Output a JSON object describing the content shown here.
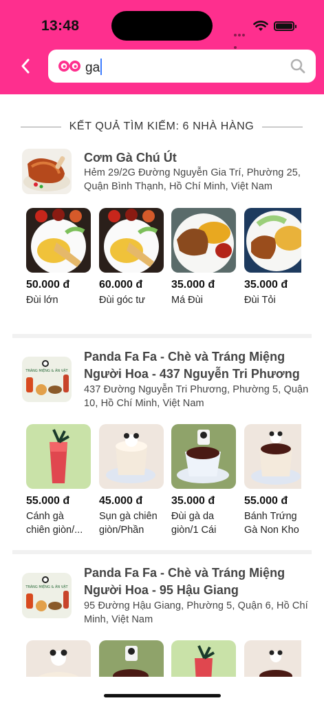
{
  "status_bar": {
    "time": "13:48"
  },
  "search": {
    "query": "ga"
  },
  "results": {
    "title": "KẾT QUẢ TÌM KIẾM: 6 NHÀ HÀNG"
  },
  "restaurants": [
    {
      "name": "Cơm Gà Chú Út",
      "address": "Hẻm 29/2G Đường Nguyễn Gia Trí, Phường 25, Quận Bình Thạnh, Hồ Chí Minh, Việt Nam",
      "dishes": [
        {
          "price": "50.000 đ",
          "name": "Đùi lớn"
        },
        {
          "price": "60.000 đ",
          "name": "Đùi góc tư"
        },
        {
          "price": "35.000 đ",
          "name": "Má Đùi"
        },
        {
          "price": "35.000 đ",
          "name": "Đùi Tỏi"
        }
      ]
    },
    {
      "name": "Panda Fa Fa - Chè và Tráng Miệng Người Hoa - 437 Nguyễn Tri Phương",
      "address": "437 Đường Nguyễn Tri Phương, Phường 5, Quận 10, Hồ Chí Minh, Việt Nam",
      "dishes": [
        {
          "price": "55.000 đ",
          "name": "Cánh gà chiên giòn/..."
        },
        {
          "price": "45.000 đ",
          "name": "Sụn gà chiên giòn/Phần"
        },
        {
          "price": "35.000 đ",
          "name": "Đùi gà da giòn/1 Cái"
        },
        {
          "price": "55.000 đ",
          "name": "Bánh Trứng Gà Non Kho"
        }
      ]
    },
    {
      "name": "Panda Fa Fa - Chè và Tráng Miệng Người Hoa - 95 Hậu Giang",
      "address": "95 Đường Hậu Giang, Phường 5, Quận 6, Hồ Chí Minh, Việt Nam",
      "dishes": [
        {},
        {},
        {},
        {}
      ]
    }
  ],
  "icons": {
    "back": "chevron-left-icon",
    "search": "magnifier-icon",
    "logo": "eyes-logo-icon"
  },
  "colors": {
    "brand": "#fe2f8e"
  }
}
